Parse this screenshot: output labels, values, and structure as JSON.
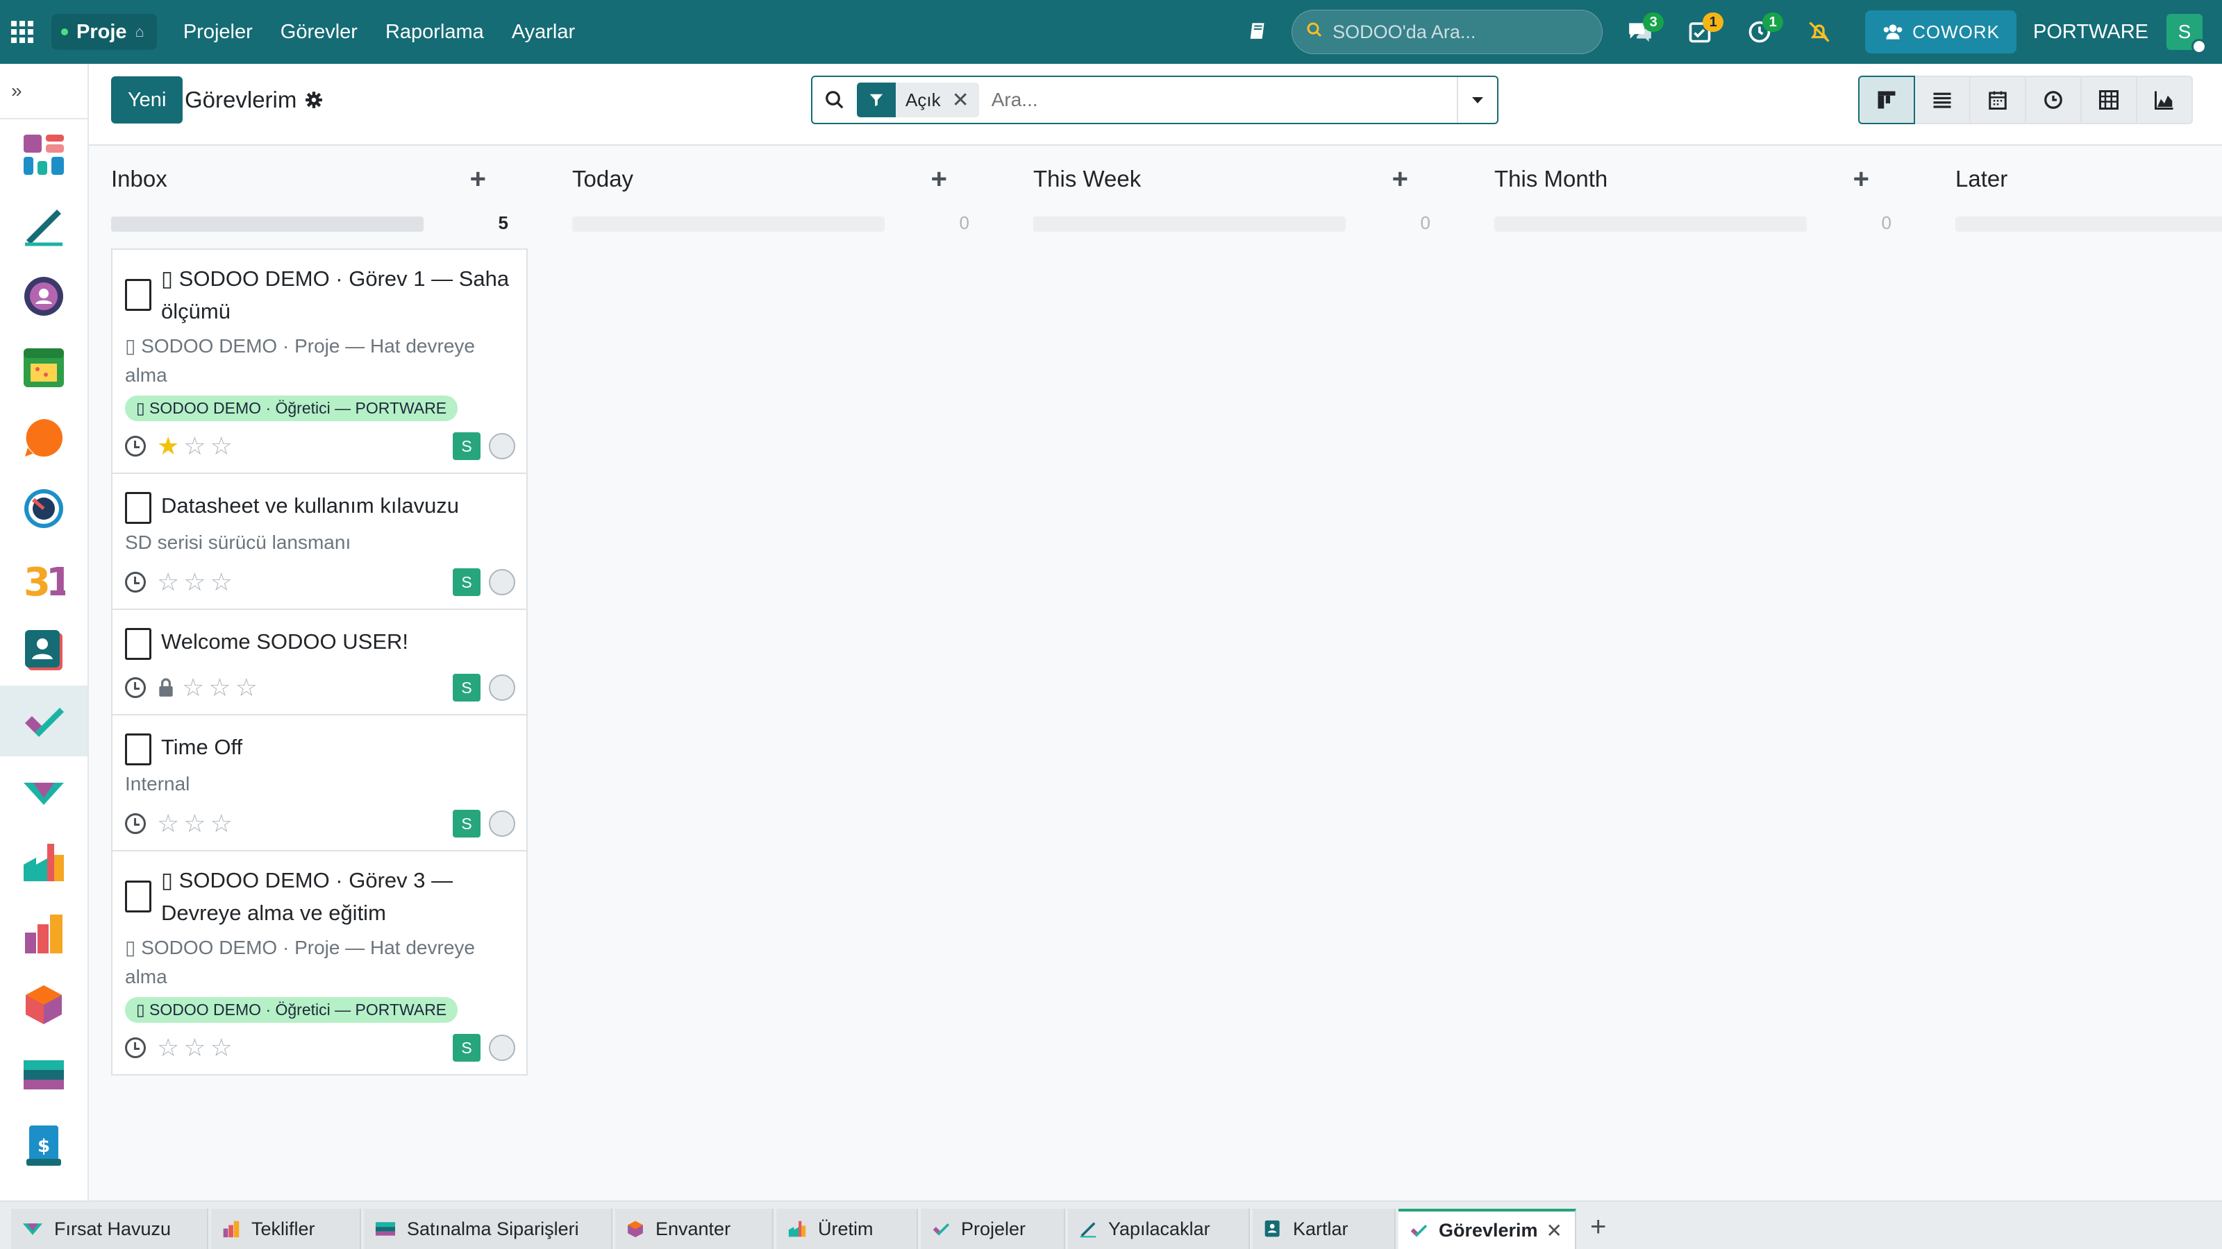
{
  "navbar": {
    "app_name": "Proje",
    "menu": [
      "Projeler",
      "Görevler",
      "Raporlama",
      "Ayarlar"
    ],
    "search_placeholder": "SODOO'da Ara...",
    "messages_badge": "3",
    "activities_badge": "1",
    "timer_badge": "1",
    "cowork_label": "COWORK",
    "company": "PORTWARE",
    "user_initial": "S"
  },
  "sidebar": {
    "toggle_label": "»",
    "items": [
      "dashboard-app",
      "sign-app",
      "team-app",
      "calendar-app",
      "discuss-app",
      "dashboard-gauge-app",
      "calendar-31-app",
      "contacts-app",
      "project-app",
      "crm-app",
      "manufacturing-app",
      "reports-app",
      "inventory-app",
      "purchase-app",
      "invoicing-app"
    ]
  },
  "control": {
    "new_label": "Yeni",
    "breadcrumb": "Görevlerim",
    "facet_label": "Açık",
    "search_placeholder": "Ara...",
    "views": [
      "kanban",
      "list",
      "calendar",
      "activity",
      "pivot",
      "graph"
    ]
  },
  "columns": [
    {
      "title": "Inbox",
      "count": "5"
    },
    {
      "title": "Today",
      "count": "0"
    },
    {
      "title": "This Week",
      "count": "0"
    },
    {
      "title": "This Month",
      "count": "0"
    },
    {
      "title": "Later",
      "count": ""
    }
  ],
  "cards": [
    {
      "title": "▯ SODOO DEMO · Görev 1 — Saha ölçümü",
      "subtitle": "▯ SODOO DEMO · Proje — Hat devreye alma",
      "tag": "▯ SODOO DEMO · Öğretici — PORTWARE",
      "priority_stars": 1,
      "locked": false,
      "assignee": "S"
    },
    {
      "title": "Datasheet ve kullanım kılavuzu",
      "subtitle": "SD serisi sürücü lansmanı",
      "tag": "",
      "priority_stars": 0,
      "locked": false,
      "assignee": "S"
    },
    {
      "title": "Welcome SODOO USER!",
      "subtitle": "",
      "tag": "",
      "priority_stars": 0,
      "locked": true,
      "assignee": "S"
    },
    {
      "title": "Time Off",
      "subtitle": "Internal",
      "tag": "",
      "priority_stars": 0,
      "locked": false,
      "assignee": "S"
    },
    {
      "title": "▯ SODOO DEMO · Görev 3 — Devreye alma ve eğitim",
      "subtitle": "▯ SODOO DEMO · Proje — Hat devreye alma",
      "tag": "▯ SODOO DEMO · Öğretici — PORTWARE",
      "priority_stars": 0,
      "locked": false,
      "assignee": "S"
    }
  ],
  "bottom_tabs": [
    {
      "label": "Fırsat Havuzu",
      "icon": "crm-icon"
    },
    {
      "label": "Teklifler",
      "icon": "quotes-icon"
    },
    {
      "label": "Satınalma Siparişleri",
      "icon": "purchase-icon"
    },
    {
      "label": "Envanter",
      "icon": "inventory-icon"
    },
    {
      "label": "Üretim",
      "icon": "manufacturing-icon"
    },
    {
      "label": "Projeler",
      "icon": "project-icon"
    },
    {
      "label": "Yapılacaklar",
      "icon": "todo-icon"
    },
    {
      "label": "Kartlar",
      "icon": "contacts-icon"
    },
    {
      "label": "Görevlerim",
      "icon": "project-icon",
      "active": true
    }
  ],
  "colors": {
    "brand": "#156c75",
    "tag_green": "#b5f0c7",
    "avatar_green": "#27a67d",
    "star_gold": "#f3c20c"
  }
}
